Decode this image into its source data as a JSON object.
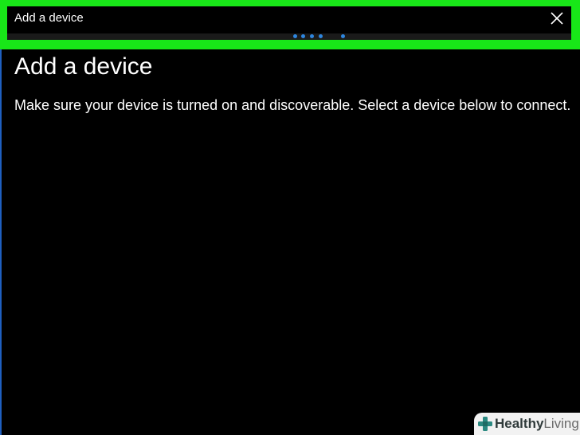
{
  "window": {
    "title": "Add a device",
    "close_label": "Close"
  },
  "progress": {
    "state": "indeterminate",
    "dot_color": "#2e86de"
  },
  "main": {
    "heading": "Add a device",
    "description": "Make sure your device is turned on and discoverable. Select a device below to connect."
  },
  "watermark": {
    "brand_bold": "Healthy",
    "brand_light": "Living",
    "icon": "cross-icon"
  },
  "colors": {
    "highlight": "#18e718",
    "background": "#000000",
    "text": "#ffffff",
    "accent": "#2e86de"
  }
}
